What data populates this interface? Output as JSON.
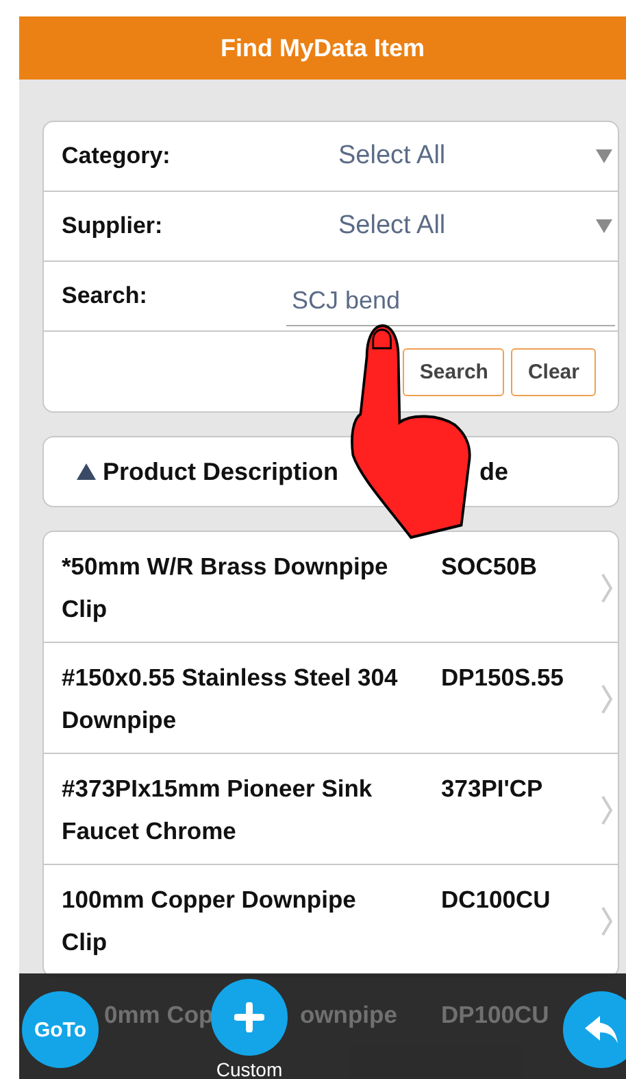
{
  "header": {
    "title": "Find MyData Item"
  },
  "filters": [
    {
      "kind": "select",
      "label": "Category:",
      "value": "Select All"
    },
    {
      "kind": "select",
      "label": "Supplier:",
      "value": "Select All"
    },
    {
      "kind": "text",
      "label": "Search:",
      "value": "SCJ bend"
    }
  ],
  "actions": [
    {
      "label": "Search"
    },
    {
      "label": "Clear"
    }
  ],
  "list_header": {
    "column_1": "Product Description",
    "column_2": "de"
  },
  "items": [
    {
      "description": "*50mm W/R Brass Downpipe Clip",
      "code": "SOC50B"
    },
    {
      "description": "#150x0.55 Stainless Steel 304 Downpipe",
      "code": "DP150S.55"
    },
    {
      "description": "#373PIx15mm Pioneer Sink Faucet Chrome",
      "code": "373PI'CP"
    },
    {
      "description": "100mm Copper Downpipe Clip",
      "code": "DC100CU"
    }
  ],
  "covered_row": [
    "0mm Cop",
    "ownpipe",
    "DP100CU"
  ],
  "footer": {
    "goto": "GoTo",
    "custom": "Custom"
  }
}
